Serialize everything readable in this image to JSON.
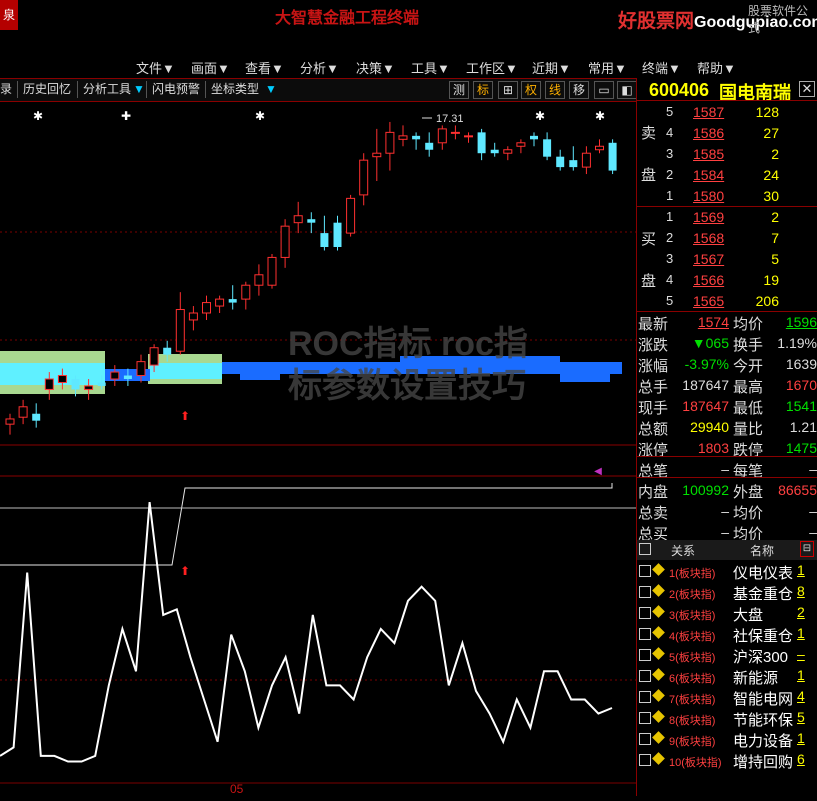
{
  "window": {
    "app_logo": "泉",
    "title": "大智慧金融工程终端",
    "watermark_site": "好股票网",
    "watermark_domain": "Goodgupiao.com",
    "soft_label": "股票软件公式"
  },
  "menu": [
    "文件▼",
    "画面▼",
    "查看▼",
    "分析▼",
    "决策▼",
    "工具▼",
    "工作区▼",
    "近期▼",
    "常用▼",
    "终端▼",
    "帮助▼"
  ],
  "toolbar": {
    "items": [
      "录",
      "历史回忆",
      "分析工具",
      "闪电预警",
      "坐标类型"
    ],
    "right_buttons": [
      "测",
      "标",
      "⊞",
      "权",
      "线",
      "移",
      "▭",
      "◧"
    ]
  },
  "chart": {
    "price_annotation": "17.31",
    "watermark_line1": "ROC指标 roc指",
    "watermark_line2": "标参数设置技巧",
    "bottom_label": "05",
    "colors": {
      "up": "#ff3030",
      "down": "#5fe8ff",
      "line": "#ffffff",
      "cloud_green": "#a8d890",
      "cloud_blue": "#1a6cff"
    }
  },
  "chart_data": [
    {
      "type": "candlestick",
      "title": "",
      "annotations": [
        "17.31"
      ],
      "candles": [
        {
          "o": 8.6,
          "h": 8.9,
          "l": 8.3,
          "c": 8.75
        },
        {
          "o": 8.8,
          "h": 9.3,
          "l": 8.6,
          "c": 9.1
        },
        {
          "o": 8.9,
          "h": 9.2,
          "l": 8.5,
          "c": 8.7
        },
        {
          "o": 9.6,
          "h": 10.1,
          "l": 9.3,
          "c": 9.9
        },
        {
          "o": 9.8,
          "h": 10.2,
          "l": 9.6,
          "c": 10.0
        },
        {
          "o": 9.9,
          "h": 10.0,
          "l": 9.4,
          "c": 9.6
        },
        {
          "o": 9.6,
          "h": 9.9,
          "l": 9.3,
          "c": 9.7
        },
        {
          "o": 9.8,
          "h": 10.0,
          "l": 9.6,
          "c": 9.7
        },
        {
          "o": 9.9,
          "h": 10.3,
          "l": 9.7,
          "c": 10.1
        },
        {
          "o": 10.0,
          "h": 10.2,
          "l": 9.7,
          "c": 9.9
        },
        {
          "o": 10.0,
          "h": 10.6,
          "l": 9.8,
          "c": 10.4
        },
        {
          "o": 10.3,
          "h": 10.9,
          "l": 10.1,
          "c": 10.8
        },
        {
          "o": 10.8,
          "h": 11.0,
          "l": 10.4,
          "c": 10.6
        },
        {
          "o": 10.7,
          "h": 12.4,
          "l": 10.6,
          "c": 11.9
        },
        {
          "o": 11.6,
          "h": 12.0,
          "l": 11.3,
          "c": 11.8
        },
        {
          "o": 11.8,
          "h": 12.3,
          "l": 11.6,
          "c": 12.1
        },
        {
          "o": 12.0,
          "h": 12.3,
          "l": 11.8,
          "c": 12.2
        },
        {
          "o": 12.2,
          "h": 12.6,
          "l": 11.9,
          "c": 12.1
        },
        {
          "o": 12.2,
          "h": 12.7,
          "l": 11.9,
          "c": 12.6
        },
        {
          "o": 12.6,
          "h": 13.2,
          "l": 12.3,
          "c": 12.9
        },
        {
          "o": 12.6,
          "h": 13.5,
          "l": 12.5,
          "c": 13.4
        },
        {
          "o": 13.4,
          "h": 14.5,
          "l": 13.1,
          "c": 14.3
        },
        {
          "o": 14.4,
          "h": 15.0,
          "l": 14.1,
          "c": 14.6
        },
        {
          "o": 14.5,
          "h": 14.7,
          "l": 14.1,
          "c": 14.4
        },
        {
          "o": 14.1,
          "h": 14.6,
          "l": 13.6,
          "c": 13.7
        },
        {
          "o": 14.4,
          "h": 14.6,
          "l": 13.6,
          "c": 13.7
        },
        {
          "o": 14.1,
          "h": 15.2,
          "l": 14.0,
          "c": 15.1
        },
        {
          "o": 15.2,
          "h": 16.4,
          "l": 14.9,
          "c": 16.2
        },
        {
          "o": 16.3,
          "h": 17.1,
          "l": 15.6,
          "c": 16.4
        },
        {
          "o": 16.4,
          "h": 17.3,
          "l": 15.9,
          "c": 17.0
        },
        {
          "o": 16.8,
          "h": 17.2,
          "l": 16.6,
          "c": 16.9
        },
        {
          "o": 16.9,
          "h": 17.0,
          "l": 16.5,
          "c": 16.8
        },
        {
          "o": 16.7,
          "h": 17.0,
          "l": 16.3,
          "c": 16.5
        },
        {
          "o": 16.7,
          "h": 17.2,
          "l": 16.5,
          "c": 17.1
        },
        {
          "o": 17.0,
          "h": 17.2,
          "l": 16.8,
          "c": 17.0
        },
        {
          "o": 16.9,
          "h": 17.0,
          "l": 16.7,
          "c": 16.9
        },
        {
          "o": 17.0,
          "h": 17.1,
          "l": 16.2,
          "c": 16.4
        },
        {
          "o": 16.5,
          "h": 16.7,
          "l": 16.3,
          "c": 16.4
        },
        {
          "o": 16.4,
          "h": 16.6,
          "l": 16.2,
          "c": 16.5
        },
        {
          "o": 16.6,
          "h": 16.8,
          "l": 16.4,
          "c": 16.7
        },
        {
          "o": 16.9,
          "h": 17.0,
          "l": 16.6,
          "c": 16.8
        },
        {
          "o": 16.8,
          "h": 17.0,
          "l": 16.2,
          "c": 16.3
        },
        {
          "o": 16.3,
          "h": 16.5,
          "l": 15.9,
          "c": 16.0
        },
        {
          "o": 16.2,
          "h": 16.6,
          "l": 15.9,
          "c": 16.0
        },
        {
          "o": 16.0,
          "h": 16.6,
          "l": 15.8,
          "c": 16.4
        },
        {
          "o": 16.5,
          "h": 16.8,
          "l": 16.4,
          "c": 16.6
        },
        {
          "o": 16.7,
          "h": 16.8,
          "l": 15.8,
          "c": 15.9
        }
      ]
    },
    {
      "type": "line",
      "title": "",
      "x_label": "05",
      "series": [
        {
          "values": [
            5,
            8,
            70,
            5,
            5,
            3,
            3,
            5,
            30,
            50,
            35,
            95,
            55,
            57,
            40,
            25,
            10,
            48,
            35,
            15,
            30,
            40,
            20,
            55,
            30,
            30,
            25,
            40,
            50,
            45,
            60,
            65,
            60,
            30,
            45,
            28,
            20,
            10,
            25,
            15,
            35,
            35,
            25,
            25,
            20,
            22
          ]
        }
      ]
    }
  ],
  "stock": {
    "code": "600406",
    "name": "国电南瑞",
    "close_label": "✕"
  },
  "orderbook": {
    "sell_label": [
      "卖",
      "盘"
    ],
    "buy_label": [
      "买",
      "盘"
    ],
    "asks": [
      {
        "level": "5",
        "price": "1587",
        "volume": "128"
      },
      {
        "level": "4",
        "price": "1586",
        "volume": "27"
      },
      {
        "level": "3",
        "price": "1585",
        "volume": "2"
      },
      {
        "level": "2",
        "price": "1584",
        "volume": "24"
      },
      {
        "level": "1",
        "price": "1580",
        "volume": "30"
      }
    ],
    "bids": [
      {
        "level": "1",
        "price": "1569",
        "volume": "2"
      },
      {
        "level": "2",
        "price": "1568",
        "volume": "7"
      },
      {
        "level": "3",
        "price": "1567",
        "volume": "5"
      },
      {
        "level": "4",
        "price": "1566",
        "volume": "19"
      },
      {
        "level": "5",
        "price": "1565",
        "volume": "206"
      }
    ]
  },
  "quote": [
    {
      "l1": "最新",
      "v1": "1574",
      "c1": "red",
      "u1": true,
      "l2": "均价",
      "v2": "1596",
      "c2": "grn",
      "u2": true
    },
    {
      "l1": "涨跌",
      "v1": "▼065",
      "c1": "grn",
      "u1": false,
      "l2": "换手",
      "v2": "1.19%",
      "c2": "wht",
      "u2": false
    },
    {
      "l1": "涨幅",
      "v1": "-3.97%",
      "c1": "grn",
      "u1": false,
      "l2": "今开",
      "v2": "1639",
      "c2": "wht",
      "u2": false
    },
    {
      "l1": "总手",
      "v1": "187647",
      "c1": "wht",
      "u1": false,
      "l2": "最高",
      "v2": "1670",
      "c2": "red",
      "u2": false
    },
    {
      "l1": "现手",
      "v1": "187647",
      "c1": "red",
      "u1": false,
      "l2": "最低",
      "v2": "1541",
      "c2": "grn",
      "u2": false
    },
    {
      "l1": "总额",
      "v1": "29940",
      "c1": "yel",
      "u1": false,
      "l2": "量比",
      "v2": "1.21",
      "c2": "wht",
      "u2": false
    },
    {
      "l1": "涨停",
      "v1": "1803",
      "c1": "red",
      "u1": false,
      "l2": "跌停",
      "v2": "1475",
      "c2": "grn",
      "u2": false
    },
    {
      "l1": "总笔",
      "v1": "–",
      "c1": "wht",
      "u1": false,
      "l2": "每笔",
      "v2": "–",
      "c2": "wht",
      "u2": false
    },
    {
      "l1": "内盘",
      "v1": "100992",
      "c1": "grn",
      "u1": false,
      "l2": "外盘",
      "v2": "86655",
      "c2": "red",
      "u2": false
    },
    {
      "l1": "总卖",
      "v1": "–",
      "c1": "wht",
      "u1": false,
      "l2": "均价",
      "v2": "–",
      "c2": "wht",
      "u2": false
    },
    {
      "l1": "总买",
      "v1": "–",
      "c1": "wht",
      "u1": false,
      "l2": "均价",
      "v2": "–",
      "c2": "wht",
      "u2": false
    }
  ],
  "related": {
    "head_rel": "关系",
    "head_name": "名称",
    "rows": [
      {
        "idx": "1(板块指)",
        "name": "仪电仪表",
        "count": "1"
      },
      {
        "idx": "2(板块指)",
        "name": "基金重仓",
        "count": "8"
      },
      {
        "idx": "3(板块指)",
        "name": "大盘",
        "count": "2"
      },
      {
        "idx": "4(板块指)",
        "name": "社保重仓",
        "count": "1"
      },
      {
        "idx": "5(板块指)",
        "name": "沪深300",
        "count": "–"
      },
      {
        "idx": "6(板块指)",
        "name": "新能源",
        "count": "1"
      },
      {
        "idx": "7(板块指)",
        "name": "智能电网",
        "count": "4"
      },
      {
        "idx": "8(板块指)",
        "name": "节能环保",
        "count": "5"
      },
      {
        "idx": "9(板块指)",
        "name": "电力设备",
        "count": "1"
      },
      {
        "idx": "10(板块指)",
        "name": "增持回购",
        "count": "6"
      }
    ]
  }
}
